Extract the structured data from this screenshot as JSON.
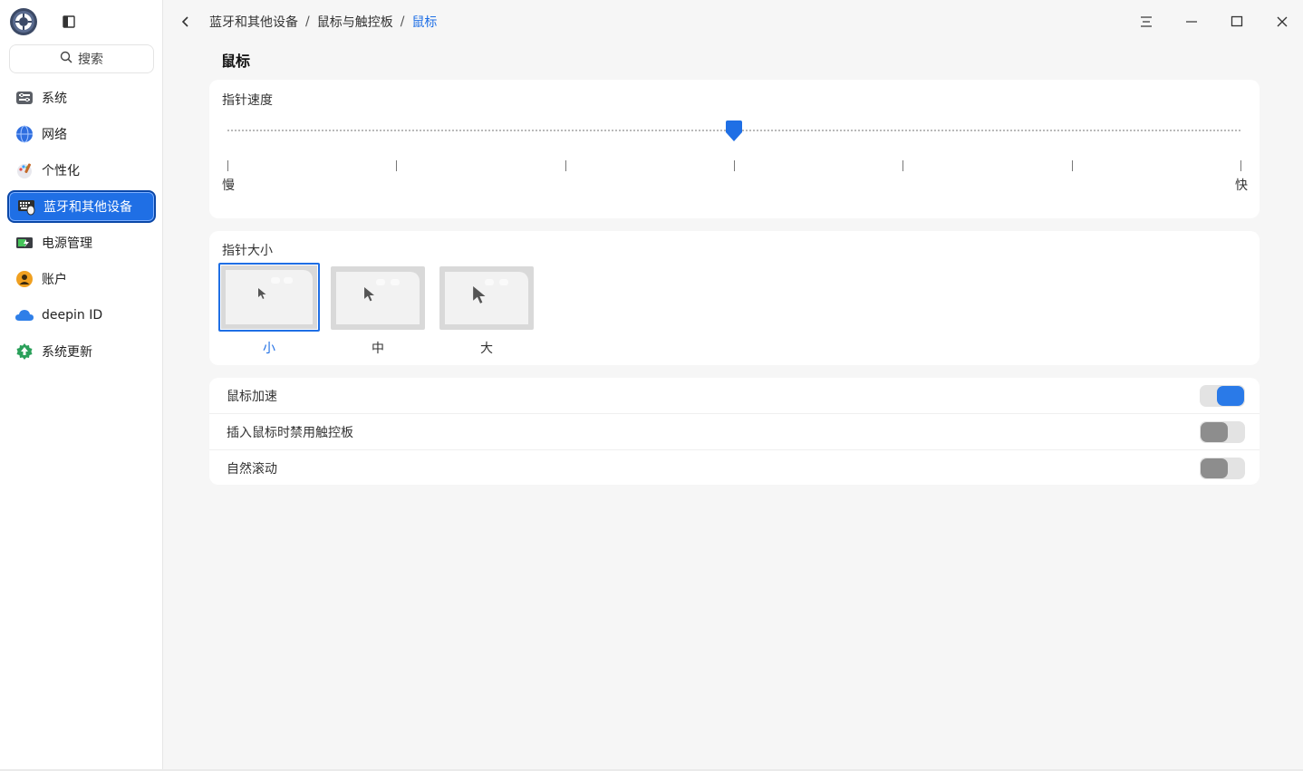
{
  "window": {
    "icons": {
      "logo": "settings-logo-icon",
      "sidebar_toggle": "sidebar-toggle-icon",
      "back": "chevron-left-icon",
      "menu": "menu-icon",
      "minimize": "minimize-icon",
      "maximize": "maximize-icon",
      "close": "close-icon"
    },
    "accent_color": "#1f6fe5"
  },
  "search": {
    "label": "搜索"
  },
  "sidebar": {
    "items": [
      {
        "label": "系统",
        "icon": "system-icon"
      },
      {
        "label": "网络",
        "icon": "network-icon"
      },
      {
        "label": "个性化",
        "icon": "personalization-icon"
      },
      {
        "label": "蓝牙和其他设备",
        "icon": "devices-icon",
        "active": true
      },
      {
        "label": "电源管理",
        "icon": "power-icon"
      },
      {
        "label": "账户",
        "icon": "account-icon"
      },
      {
        "label": "deepin ID",
        "icon": "cloud-icon"
      },
      {
        "label": "系统更新",
        "icon": "update-icon"
      }
    ]
  },
  "breadcrumb": {
    "items": [
      "蓝牙和其他设备",
      "鼠标与触控板",
      "鼠标"
    ],
    "separator": "/"
  },
  "page": {
    "title": "鼠标"
  },
  "pointer_speed": {
    "label": "指针速度",
    "min_label": "慢",
    "max_label": "快",
    "value": 0.5,
    "tick_count": 7
  },
  "pointer_size": {
    "label": "指针大小",
    "options": [
      {
        "label": "小",
        "selected": true
      },
      {
        "label": "中",
        "selected": false
      },
      {
        "label": "大",
        "selected": false
      }
    ]
  },
  "toggles": [
    {
      "label": "鼠标加速",
      "on": true
    },
    {
      "label": "插入鼠标时禁用触控板",
      "on": false
    },
    {
      "label": "自然滚动",
      "on": false
    }
  ]
}
